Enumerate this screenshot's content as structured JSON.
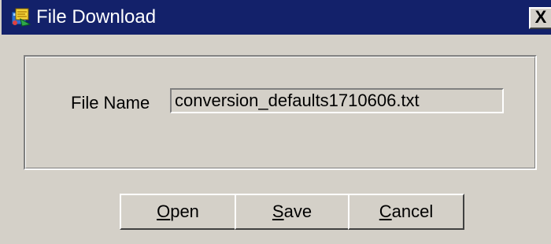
{
  "window": {
    "title": "File Download",
    "close_label": "X",
    "icon": "download-app-icon"
  },
  "form": {
    "file_name_label": "File Name",
    "file_name_value": "conversion_defaults1710606.txt"
  },
  "buttons": {
    "open": {
      "mnemonic": "O",
      "rest": "pen"
    },
    "save": {
      "mnemonic": "S",
      "rest": "ave"
    },
    "cancel": {
      "mnemonic": "C",
      "rest": "ancel"
    }
  },
  "colors": {
    "titlebar": "#13216a",
    "dialog_bg": "#d4d0c8",
    "title_text": "#ffffff"
  }
}
